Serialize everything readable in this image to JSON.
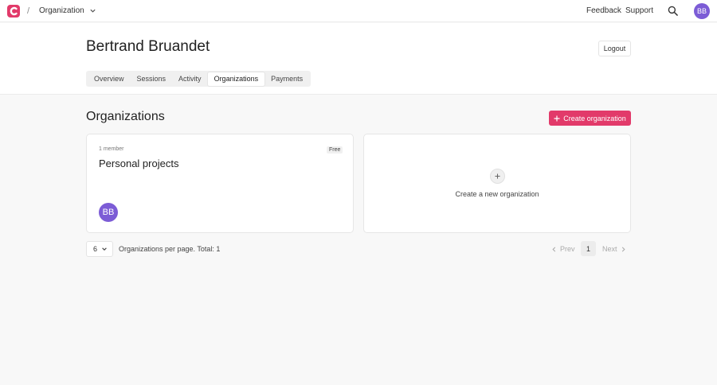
{
  "nav": {
    "logo_icon": "app-logo-icon",
    "breadcrumb_separator": "/",
    "org_switcher_label": "Organization",
    "feedback_label": "Feedback",
    "support_label": "Support",
    "avatar_initials": "BB"
  },
  "header": {
    "user_name": "Bertrand Bruandet",
    "logout_label": "Logout",
    "tabs": [
      {
        "label": "Overview",
        "active": false
      },
      {
        "label": "Sessions",
        "active": false
      },
      {
        "label": "Activity",
        "active": false
      },
      {
        "label": "Organizations",
        "active": true
      },
      {
        "label": "Payments",
        "active": false
      }
    ]
  },
  "organizations": {
    "title": "Organizations",
    "create_button_label": "Create organization",
    "cards": [
      {
        "member_count": "1 member",
        "plan": "Free",
        "name": "Personal projects",
        "member_initials": "BB"
      }
    ],
    "new_org_label": "Create a new organization"
  },
  "pagination": {
    "per_page_value": "6",
    "per_page_label": "Organizations per page. Total: 1",
    "prev_label": "Prev",
    "current_page": "1",
    "next_label": "Next"
  },
  "colors": {
    "brand": "#e23a6a",
    "avatar": "#7c5cd6",
    "background": "#f8f8f8"
  }
}
